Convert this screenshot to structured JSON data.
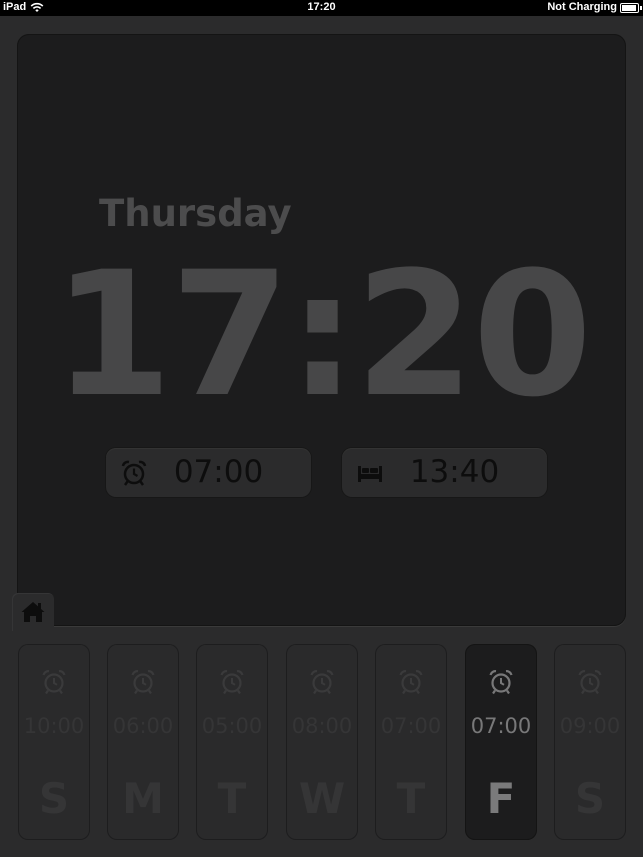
{
  "status_bar": {
    "device": "iPad",
    "time": "17:20",
    "charge": "Not Charging",
    "battery_level": 0.9
  },
  "clock": {
    "day": "Thursday",
    "time": "17:20"
  },
  "alarm_pill": {
    "icon": "alarm-clock-icon",
    "time": "07:00"
  },
  "sleep_pill": {
    "icon": "bed-icon",
    "time": "13:40"
  },
  "home_tab": {
    "icon": "home-icon"
  },
  "week": [
    {
      "letter": "S",
      "time": "10:00",
      "active": false
    },
    {
      "letter": "M",
      "time": "06:00",
      "active": false
    },
    {
      "letter": "T",
      "time": "05:00",
      "active": false
    },
    {
      "letter": "W",
      "time": "08:00",
      "active": false
    },
    {
      "letter": "T",
      "time": "07:00",
      "active": false
    },
    {
      "letter": "F",
      "time": "07:00",
      "active": true
    },
    {
      "letter": "S",
      "time": "09:00",
      "active": false
    }
  ],
  "colors": {
    "background": "#2a2a2b",
    "panel": "#1c1c1d",
    "text_dim": "#474748",
    "active_text": "#7a7a7b"
  }
}
